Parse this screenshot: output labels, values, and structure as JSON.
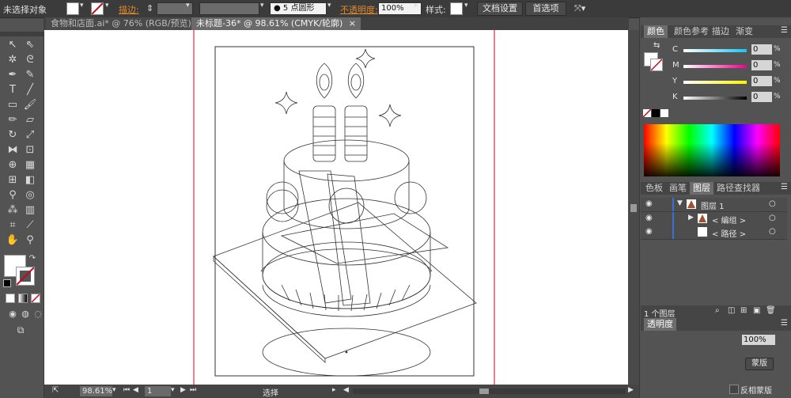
{
  "control_bar": {
    "selection_label": "未选择对象",
    "stroke_label": "描边:",
    "brush_label": "5 点圆形",
    "opacity_label": "不透明度:",
    "opacity_value": "100%",
    "style_label": "样式:",
    "doc_settings_button": "文档设置",
    "preferences_button": "首选项"
  },
  "tabs": [
    {
      "label": "食物和店面.ai* @ 76% (RGB/预览)",
      "close": "×"
    },
    {
      "label": "未标题-36* @ 98.61% (CMYK/轮廓)",
      "close": "×"
    }
  ],
  "color_panel": {
    "tabs": [
      "颜色",
      "颜色参考",
      "描边",
      "渐变"
    ],
    "channels": [
      {
        "name": "C",
        "value": "0",
        "unit": "%",
        "color": "#19c3ef"
      },
      {
        "name": "M",
        "value": "0",
        "unit": "%",
        "color": "#ec008c"
      },
      {
        "name": "Y",
        "value": "0",
        "unit": "%",
        "color": "#fff200"
      },
      {
        "name": "K",
        "value": "0",
        "unit": "%",
        "color": "#000000"
      }
    ]
  },
  "layers_panel": {
    "tabs": [
      "色板",
      "画笔",
      "图层",
      "路径查找器"
    ],
    "rows": [
      {
        "name": "图层 1"
      },
      {
        "name": "< 编组 >"
      },
      {
        "name": "< 路径 >"
      }
    ],
    "count_label": "1 个图层"
  },
  "transparency_panel": {
    "tab": "透明度",
    "opacity_value": "100%",
    "mask_button": "蒙版",
    "invert_mask_label": "反相蒙版"
  },
  "status_bar": {
    "zoom": "98.61%",
    "page": "1",
    "tool": "选择"
  },
  "accent_colors": {
    "artboard_guide": "#d0021b",
    "panel_bg": "#535353"
  }
}
